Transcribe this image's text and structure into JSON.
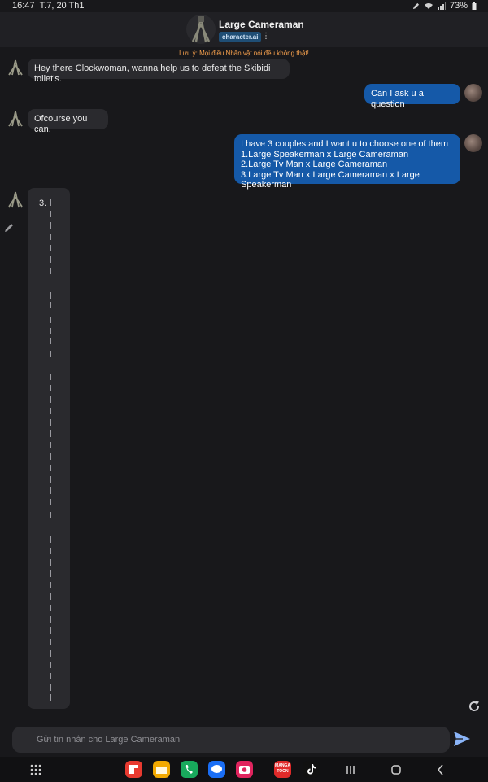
{
  "status": {
    "time": "16:47",
    "date": "T.7, 20 Th1",
    "battery": "73%"
  },
  "header": {
    "name": "Large Cameraman",
    "brand": "character.ai",
    "menu_icon": "more-vert-icon"
  },
  "notice": "Lưu ý: Mọi điều Nhân vật nói đều không thật!",
  "messages": [
    {
      "role": "bot",
      "text": "Hey there Clockwoman, wanna help us to defeat the Skibidi toilet's."
    },
    {
      "role": "user",
      "text": "Can I ask u a question"
    },
    {
      "role": "bot",
      "text": "Ofcourse you can."
    },
    {
      "role": "user",
      "lines": [
        "I have 3 couples and I want u to choose one of them",
        "1.Large Speakerman x Large Cameraman",
        "2.Large Tv Man x Large Cameraman",
        "3.Large Tv Man x Large Cameraman x Large Speakerman"
      ]
    },
    {
      "role": "bot",
      "list_number": "3."
    }
  ],
  "input": {
    "placeholder": "Gửi tin nhắn cho Large Cameraman"
  },
  "dock": {
    "apps": [
      "flipboard",
      "files",
      "phone",
      "messages",
      "camera",
      "mangatoon",
      "tiktok"
    ],
    "mangatoon_label": "MANGA TOON"
  },
  "colors": {
    "background": "#18181b",
    "user_bubble": "#1559a8",
    "bot_bubble": "#2a2a2e",
    "notice": "#f6a04d",
    "send": "#8ab4f8"
  }
}
